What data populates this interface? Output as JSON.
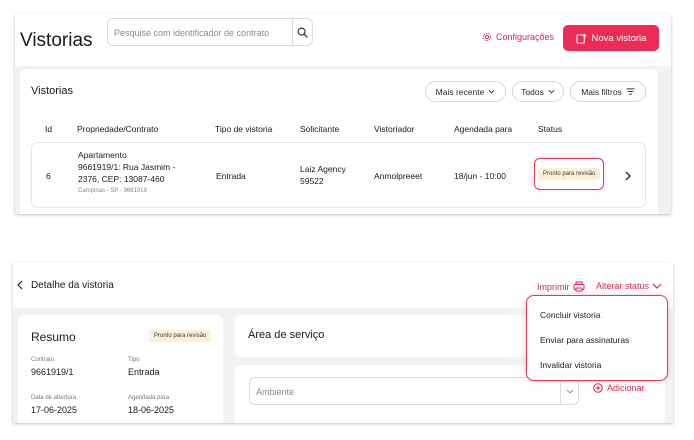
{
  "list_view": {
    "title": "Vistorias",
    "search": {
      "placeholder": "Pesquise com identificador de contrato"
    },
    "config_label": "Configurações",
    "new_button_label": "Nova vistoria",
    "card_title": "Vistorias",
    "filters": [
      {
        "label": "Mais recente"
      },
      {
        "label": "Todos"
      },
      {
        "label": "Mais filtros"
      }
    ],
    "columns": [
      "Id",
      "Propriedade/Contrato",
      "Tipo de vistoria",
      "Solicitante",
      "Vistoriador",
      "Agendada para",
      "Status"
    ],
    "row": {
      "id": "6",
      "property_line1": "Apartamento",
      "property_line2": "9661919/1: Rua Jasmim -",
      "property_line3": "2376, CEP: 13087-460",
      "property_sub": "Campinas - SP - 9661919",
      "type": "Entrada",
      "requester_line1": "Laiz Agency",
      "requester_line2": "59522",
      "inspector": "Anmolpreeet",
      "scheduled": "18/jun - 10:00",
      "status": "Pronto para revisão"
    }
  },
  "detail_view": {
    "title": "Detalhe da vistoria",
    "print_label": "Imprimir",
    "change_status_label": "Alterar status",
    "summary": {
      "title": "Resumo",
      "status": "Pronto para revisão",
      "contract_label": "Contrato",
      "contract_value": "9661919/1",
      "type_label": "Tipo",
      "type_value": "Entrada",
      "opened_label": "Data de abertura",
      "opened_value": "17-06-2025",
      "scheduled_label": "Agendada para",
      "scheduled_value": "18-06-2025"
    },
    "service_area_title": "Área de serviço",
    "ambiente_placeholder": "Ambiente",
    "add_label": "Adicionar",
    "status_menu": [
      "Concluir vistoria",
      "Enviar para assinaturas",
      "Invalidar vistoria"
    ]
  },
  "colors": {
    "accent": "#ee2a56",
    "badge_bg": "#fbf0d6",
    "panel_bg": "#f2f2f3"
  },
  "icons": [
    "search-icon",
    "gear-icon",
    "new-inspection-icon",
    "chevron-down-icon",
    "filter-icon",
    "chevron-right-icon",
    "chevron-left-icon",
    "printer-icon",
    "plus-circle-icon"
  ]
}
